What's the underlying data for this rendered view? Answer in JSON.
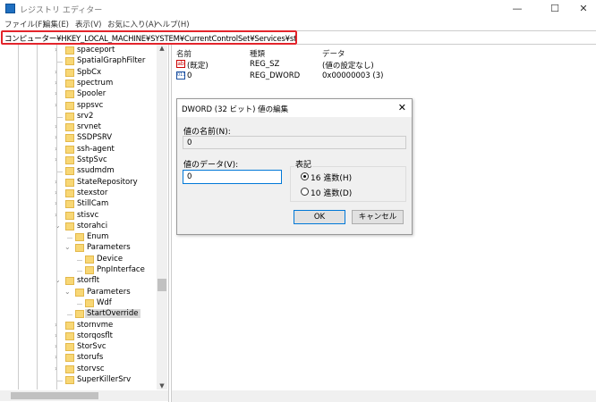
{
  "window": {
    "title": "レジストリ エディター",
    "minimize": "—",
    "maximize": "☐",
    "close": "✕"
  },
  "menu": [
    "ファイル(F)",
    "編集(E)",
    "表示(V)",
    "お気に入り(A)",
    "ヘルプ(H)"
  ],
  "address": "コンピューター¥HKEY_LOCAL_MACHINE¥SYSTEM¥CurrentControlSet¥Services¥storflt¥StartOverride",
  "tree": [
    {
      "label": "spaceport",
      "level": 0,
      "exp": "collapsed"
    },
    {
      "label": "SpatialGraphFilter",
      "level": 0,
      "exp": "none"
    },
    {
      "label": "SpbCx",
      "level": 0,
      "exp": "collapsed"
    },
    {
      "label": "spectrum",
      "level": 0,
      "exp": "collapsed"
    },
    {
      "label": "Spooler",
      "level": 0,
      "exp": "collapsed"
    },
    {
      "label": "sppsvc",
      "level": 0,
      "exp": "collapsed"
    },
    {
      "label": "srv2",
      "level": 0,
      "exp": "none"
    },
    {
      "label": "srvnet",
      "level": 0,
      "exp": "collapsed"
    },
    {
      "label": "SSDPSRV",
      "level": 0,
      "exp": "collapsed"
    },
    {
      "label": "ssh-agent",
      "level": 0,
      "exp": "collapsed"
    },
    {
      "label": "SstpSvc",
      "level": 0,
      "exp": "collapsed"
    },
    {
      "label": "ssudmdm",
      "level": 0,
      "exp": "none"
    },
    {
      "label": "StateRepository",
      "level": 0,
      "exp": "collapsed"
    },
    {
      "label": "stexstor",
      "level": 0,
      "exp": "collapsed"
    },
    {
      "label": "StillCam",
      "level": 0,
      "exp": "collapsed"
    },
    {
      "label": "stisvc",
      "level": 0,
      "exp": "collapsed"
    },
    {
      "label": "storahci",
      "level": 0,
      "exp": "expanded"
    },
    {
      "label": "Enum",
      "level": 1,
      "exp": "none"
    },
    {
      "label": "Parameters",
      "level": 1,
      "exp": "expanded"
    },
    {
      "label": "Device",
      "level": 2,
      "exp": "none"
    },
    {
      "label": "PnpInterface",
      "level": 2,
      "exp": "none"
    },
    {
      "label": "storflt",
      "level": 0,
      "exp": "expanded"
    },
    {
      "label": "Parameters",
      "level": 1,
      "exp": "expanded"
    },
    {
      "label": "Wdf",
      "level": 2,
      "exp": "none"
    },
    {
      "label": "StartOverride",
      "level": 1,
      "exp": "none",
      "selected": true
    },
    {
      "label": "stornvme",
      "level": 0,
      "exp": "collapsed"
    },
    {
      "label": "storqosflt",
      "level": 0,
      "exp": "collapsed"
    },
    {
      "label": "StorSvc",
      "level": 0,
      "exp": "collapsed"
    },
    {
      "label": "storufs",
      "level": 0,
      "exp": "collapsed"
    },
    {
      "label": "storvsc",
      "level": 0,
      "exp": "collapsed"
    },
    {
      "label": "SuperKillerSrv",
      "level": 0,
      "exp": "none"
    }
  ],
  "list": {
    "headers": [
      "名前",
      "種類",
      "データ"
    ],
    "rows": [
      {
        "icon": "ab",
        "name": "(既定)",
        "type": "REG_SZ",
        "data": "(値の設定なし)"
      },
      {
        "icon": "bin",
        "name": "0",
        "type": "REG_DWORD",
        "data": "0x00000003 (3)"
      }
    ]
  },
  "dialog": {
    "title": "DWORD (32 ビット) 値の編集",
    "close": "✕",
    "name_label": "値の名前(N):",
    "name_value": "0",
    "data_label": "値のデータ(V):",
    "data_value": "0",
    "base_label": "表記",
    "hex_label": "16 進数(H)",
    "dec_label": "10 進数(D)",
    "base_selected": "hex",
    "ok": "OK",
    "cancel": "キャンセル"
  },
  "colors": {
    "highlight": "#e3242b",
    "folder": "#f8d775"
  }
}
